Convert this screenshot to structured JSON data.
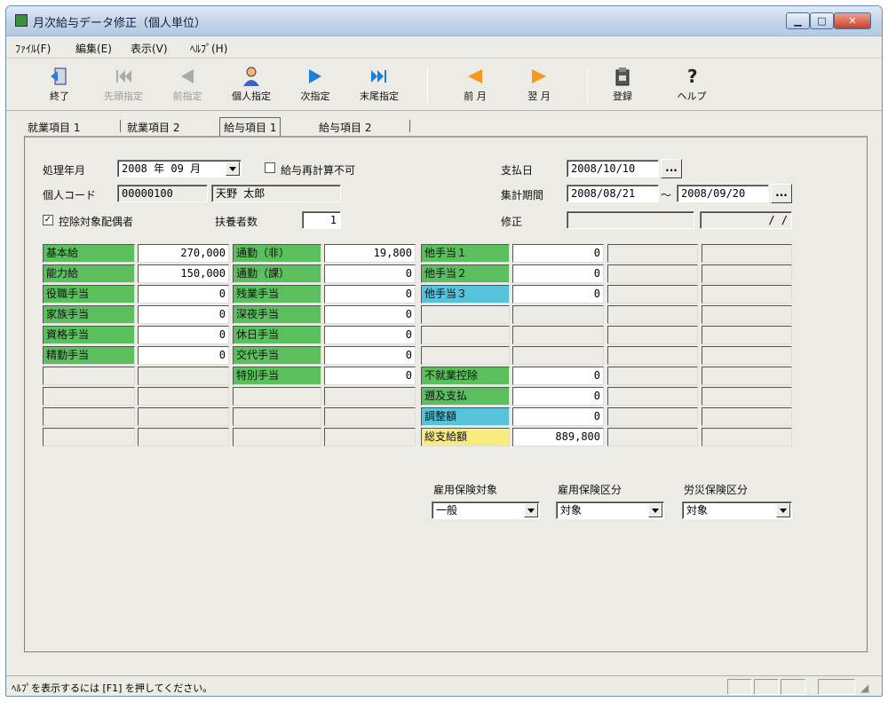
{
  "window": {
    "title": "月次給与データ修正（個人単位）"
  },
  "menu": [
    "ﾌｧｲﾙ(F)",
    "編集(E)",
    "表示(V)",
    "ﾍﾙﾌﾟ(H)"
  ],
  "toolbar": {
    "exit": "終了",
    "first": "先頭指定",
    "prev": "前指定",
    "person": "個人指定",
    "next": "次指定",
    "last": "末尾指定",
    "prev_month": "前 月",
    "next_month": "翌 月",
    "register": "登録",
    "help": "ヘルプ"
  },
  "tabs": [
    "就業項目 1",
    "就業項目 2",
    "給与項目 1",
    "給与項目 2"
  ],
  "header": {
    "period_label": "処理年月",
    "period_value": "2008 年 09 月",
    "no_recalc_label": "給与再計算不可",
    "pay_date_label": "支払日",
    "pay_date_value": "2008/10/10",
    "code_label": "個人コード",
    "code_value": "00000100",
    "name_value": "天野 太郎",
    "agg_period_label": "集計期間",
    "agg_from": "2008/08/21",
    "agg_tilde": "～",
    "agg_to": "2008/09/20",
    "deduct_spouse_label": "控除対象配偶者",
    "dependents_label": "扶養者数",
    "dependents_value": "1",
    "modify_label": "修正",
    "modify_date": "/ /",
    "ellipsis": "..."
  },
  "grid": {
    "col1": [
      {
        "label": "基本給",
        "value": "270,000"
      },
      {
        "label": "能力給",
        "value": "150,000"
      },
      {
        "label": "役職手当",
        "value": "0"
      },
      {
        "label": "家族手当",
        "value": "0"
      },
      {
        "label": "資格手当",
        "value": "0"
      },
      {
        "label": "精勤手当",
        "value": "0"
      }
    ],
    "col2": [
      {
        "label": "通勤（非）",
        "value": "19,800"
      },
      {
        "label": "通勤（課）",
        "value": "0"
      },
      {
        "label": "残業手当",
        "value": "0"
      },
      {
        "label": "深夜手当",
        "value": "0"
      },
      {
        "label": "休日手当",
        "value": "0"
      },
      {
        "label": "交代手当",
        "value": "0"
      },
      {
        "label": "特別手当",
        "value": "0"
      }
    ],
    "col3_top": [
      {
        "label": "他手当１",
        "value": "0"
      },
      {
        "label": "他手当２",
        "value": "0"
      },
      {
        "label": "他手当３",
        "value": "0"
      }
    ],
    "col3_bottom": [
      {
        "label": "不就業控除",
        "value": "0"
      },
      {
        "label": "遡及支払",
        "value": "0"
      },
      {
        "label": "調整額",
        "value": "0"
      },
      {
        "label": "総支給額",
        "value": "889,800"
      }
    ]
  },
  "insurance": {
    "employment_label": "雇用保険対象",
    "employment_value": "一般",
    "employment_class_label": "雇用保険区分",
    "employment_class_value": "対象",
    "workers_label": "労災保険区分",
    "workers_value": "対象"
  },
  "status": {
    "text": "ﾍﾙﾌﾟを表示するには [F1] を押してください。"
  },
  "colors": {
    "green_label": "#5bbf5e",
    "cyan_label": "#55c3d9",
    "yellow_label": "#f7ec80"
  }
}
